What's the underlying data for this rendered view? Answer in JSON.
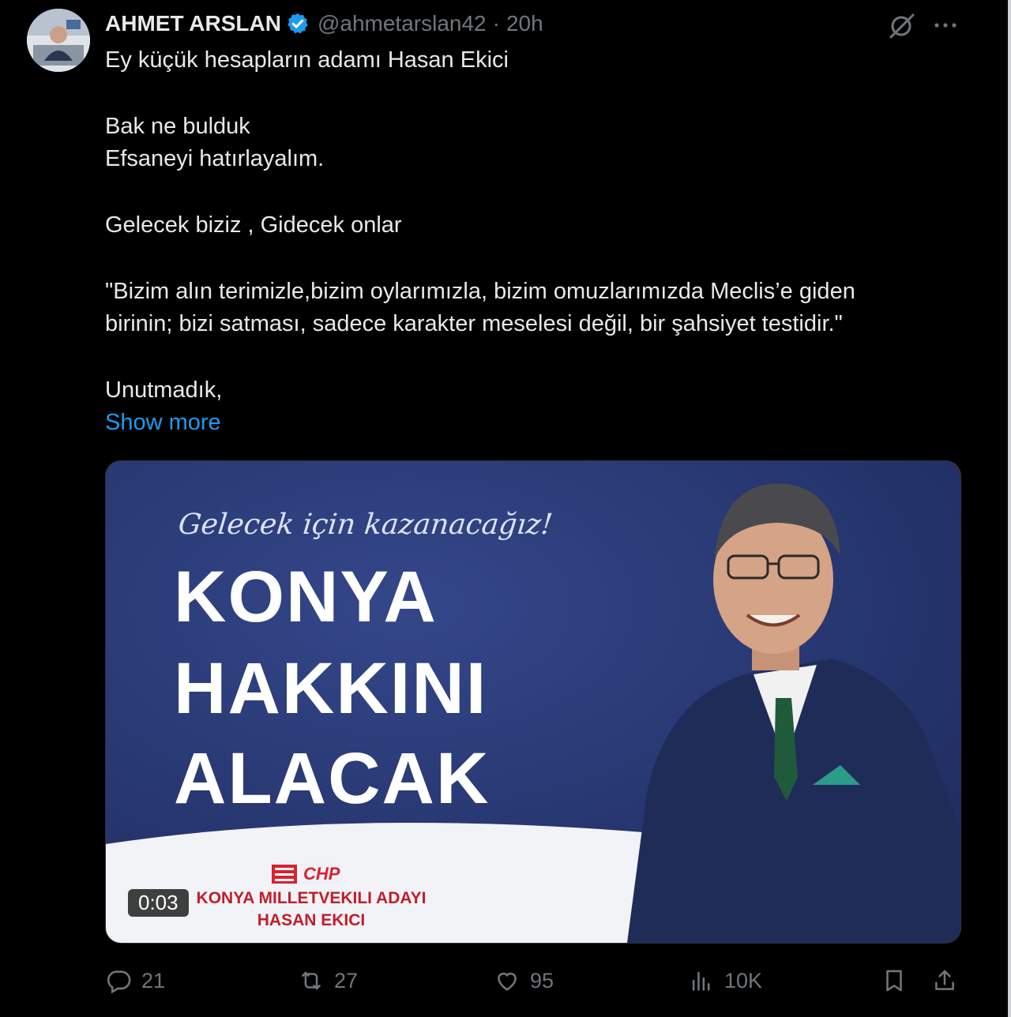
{
  "tweet": {
    "author_name": "AHMET ARSLAN",
    "handle": "@ahmetarslan42",
    "separator": "·",
    "time": "20h",
    "text_lines": [
      "Ey küçük hesapların adamı Hasan Ekici",
      "Bak ne bulduk\nEfsaneyi hatırlayalım.",
      "Gelecek biziz , Gidecek onlar",
      "\"Bizim alın terimizle,bizim oylarımızla, bizim omuzlarımızda Meclis’e giden\nbirinin; bizi satması, sadece karakter meselesi değil, bir şahsiyet testidir.\"",
      "Unutmadık,"
    ],
    "show_more": "Show more"
  },
  "media": {
    "slogan": "Gelecek için kazanacağız!",
    "headline_1": "KONYA",
    "headline_2": "HAKKINI",
    "headline_3": "ALACAK",
    "party_logo_text": "CHP",
    "candidate_title": "KONYA MILLETVEKILI ADAYI",
    "candidate_name": "HASAN EKICI",
    "video_duration": "0:03"
  },
  "actions": {
    "replies": "21",
    "retweets": "27",
    "likes": "95",
    "views": "10K"
  },
  "colors": {
    "background": "#000000",
    "text": "#e7e9ea",
    "muted": "#71767b",
    "link": "#1d9bf0",
    "verified": "#1d9bf0",
    "media_blue": "#28386e",
    "chp_red": "#d8222c"
  },
  "icons": [
    "verified-badge-icon",
    "grok-icon",
    "more-icon",
    "reply-icon",
    "retweet-icon",
    "like-icon",
    "views-icon",
    "bookmark-icon",
    "share-icon"
  ]
}
